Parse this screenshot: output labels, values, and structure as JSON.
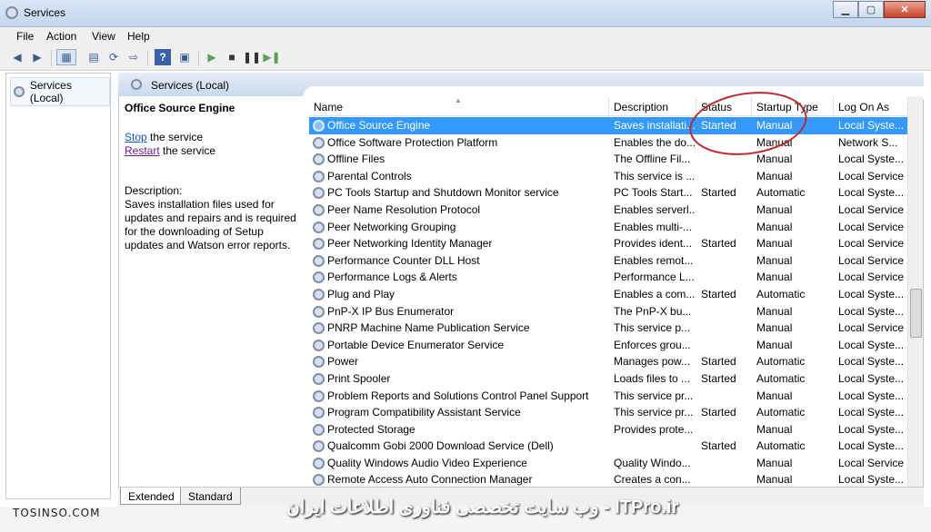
{
  "window": {
    "title": "Services",
    "minimize": "▁",
    "maximize": "▢",
    "close": "✕"
  },
  "menu": [
    "File",
    "Action",
    "View",
    "Help"
  ],
  "toolbar": [
    "back-icon",
    "forward-icon",
    "console-tree-icon",
    "properties-icon",
    "refresh-icon",
    "export-icon",
    "help-icon",
    "details-icon",
    "start-icon",
    "stop-icon",
    "pause-icon",
    "restart-icon"
  ],
  "tree": {
    "root_label": "Services (Local)"
  },
  "main_header": {
    "label": "Services (Local)"
  },
  "detail": {
    "service_name": "Office  Source Engine",
    "stop_link": "Stop",
    "stop_suffix": "the service",
    "restart_link": "Restart",
    "restart_suffix": "the service",
    "description_label": "Description:",
    "description_lines": [
      "Saves installation files used for",
      "updates and repairs and is required",
      "for the downloading of Setup",
      "updates and Watson error reports."
    ]
  },
  "columns": {
    "name": "Name",
    "description": "Description",
    "status": "Status",
    "startup_type": "Startup Type",
    "log_on_as": "Log On As"
  },
  "rows": [
    {
      "name": "Office  Source Engine",
      "desc": "Saves installati...",
      "status": "Started",
      "startup": "Manual",
      "logon": "Local Syste...",
      "selected": true
    },
    {
      "name": "Office Software Protection Platform",
      "desc": "Enables the do...",
      "status": "",
      "startup": "Manual",
      "logon": "Network S..."
    },
    {
      "name": "Offline Files",
      "desc": "The Offline Fil...",
      "status": "",
      "startup": "Manual",
      "logon": "Local Syste..."
    },
    {
      "name": "Parental Controls",
      "desc": "This service is ...",
      "status": "",
      "startup": "Manual",
      "logon": "Local Service"
    },
    {
      "name": "PC Tools Startup and Shutdown Monitor service",
      "desc": "PC Tools Start...",
      "status": "Started",
      "startup": "Automatic",
      "logon": "Local Syste..."
    },
    {
      "name": "Peer Name Resolution Protocol",
      "desc": "Enables serverl...",
      "status": "",
      "startup": "Manual",
      "logon": "Local Service"
    },
    {
      "name": "Peer Networking Grouping",
      "desc": "Enables multi-...",
      "status": "",
      "startup": "Manual",
      "logon": "Local Service"
    },
    {
      "name": "Peer Networking Identity Manager",
      "desc": "Provides ident...",
      "status": "Started",
      "startup": "Manual",
      "logon": "Local Service"
    },
    {
      "name": "Performance Counter DLL Host",
      "desc": "Enables remot...",
      "status": "",
      "startup": "Manual",
      "logon": "Local Service"
    },
    {
      "name": "Performance Logs & Alerts",
      "desc": "Performance L...",
      "status": "",
      "startup": "Manual",
      "logon": "Local Service"
    },
    {
      "name": "Plug and Play",
      "desc": "Enables a com...",
      "status": "Started",
      "startup": "Automatic",
      "logon": "Local Syste..."
    },
    {
      "name": "PnP-X IP Bus Enumerator",
      "desc": "The PnP-X bu...",
      "status": "",
      "startup": "Manual",
      "logon": "Local Syste..."
    },
    {
      "name": "PNRP Machine Name Publication Service",
      "desc": "This service p...",
      "status": "",
      "startup": "Manual",
      "logon": "Local Service"
    },
    {
      "name": "Portable Device Enumerator Service",
      "desc": "Enforces grou...",
      "status": "",
      "startup": "Manual",
      "logon": "Local Syste..."
    },
    {
      "name": "Power",
      "desc": "Manages pow...",
      "status": "Started",
      "startup": "Automatic",
      "logon": "Local Syste..."
    },
    {
      "name": "Print Spooler",
      "desc": "Loads files to ...",
      "status": "Started",
      "startup": "Automatic",
      "logon": "Local Syste..."
    },
    {
      "name": "Problem Reports and Solutions Control Panel Support",
      "desc": "This service pr...",
      "status": "",
      "startup": "Manual",
      "logon": "Local Syste..."
    },
    {
      "name": "Program Compatibility Assistant Service",
      "desc": "This service pr...",
      "status": "Started",
      "startup": "Automatic",
      "logon": "Local Syste..."
    },
    {
      "name": "Protected Storage",
      "desc": "Provides prote...",
      "status": "",
      "startup": "Manual",
      "logon": "Local Syste..."
    },
    {
      "name": "Qualcomm Gobi 2000 Download Service (Dell)",
      "desc": "",
      "status": "Started",
      "startup": "Automatic",
      "logon": "Local Syste..."
    },
    {
      "name": "Quality Windows Audio Video Experience",
      "desc": "Quality Windo...",
      "status": "",
      "startup": "Manual",
      "logon": "Local Service"
    },
    {
      "name": "Remote Access Auto Connection Manager",
      "desc": "Creates a con...",
      "status": "",
      "startup": "Manual",
      "logon": "Local Syste..."
    }
  ],
  "tabs": {
    "extended": "Extended",
    "standard": "Standard"
  },
  "watermark": {
    "left": "TOSINSO.COM",
    "center": "وب سایت تخصصی فناوری اطلاعات ایران - ITPro.ir"
  },
  "colors": {
    "selection": "#3399ff",
    "annotation": "#c0262b"
  }
}
